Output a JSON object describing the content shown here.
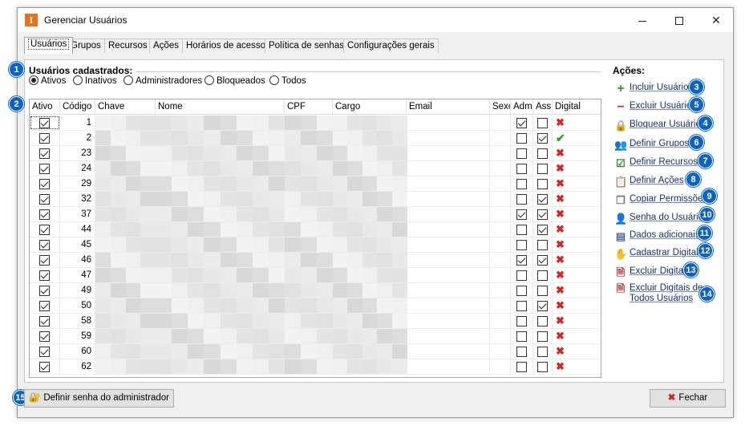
{
  "window": {
    "title": "Gerenciar Usuários",
    "app_icon": "I"
  },
  "tabs": [
    {
      "label": "Usuários",
      "active": true
    },
    {
      "label": "Grupos"
    },
    {
      "label": "Recursos"
    },
    {
      "label": "Ações"
    },
    {
      "label": "Horários de acesso"
    },
    {
      "label": "Política de senhas"
    },
    {
      "label": "Configurações gerais"
    }
  ],
  "users": {
    "section_title": "Usuários cadastrados:",
    "filters": [
      {
        "label": "Ativos",
        "selected": true
      },
      {
        "label": "Inativos"
      },
      {
        "label": "Administradores"
      },
      {
        "label": "Bloqueados"
      },
      {
        "label": "Todos"
      }
    ],
    "columns": [
      "Ativo",
      "Código",
      "Chave",
      "Nome",
      "CPF",
      "Cargo",
      "Email",
      "Sexo",
      "Adm",
      "Ass.",
      "Digital"
    ],
    "rows": [
      {
        "code": "1",
        "active": true,
        "adm": true,
        "ass": false,
        "digital": "x"
      },
      {
        "code": "2",
        "active": true,
        "adm": false,
        "ass": true,
        "digital": "ok"
      },
      {
        "code": "23",
        "active": true,
        "adm": false,
        "ass": false,
        "digital": "x"
      },
      {
        "code": "24",
        "active": true,
        "adm": false,
        "ass": false,
        "digital": "x"
      },
      {
        "code": "29",
        "active": true,
        "adm": false,
        "ass": false,
        "digital": "x"
      },
      {
        "code": "32",
        "active": true,
        "adm": false,
        "ass": true,
        "digital": "x"
      },
      {
        "code": "37",
        "active": true,
        "adm": true,
        "ass": true,
        "digital": "x"
      },
      {
        "code": "44",
        "active": true,
        "adm": false,
        "ass": true,
        "digital": "x"
      },
      {
        "code": "45",
        "active": true,
        "adm": false,
        "ass": false,
        "digital": "x"
      },
      {
        "code": "46",
        "active": true,
        "adm": true,
        "ass": true,
        "digital": "x"
      },
      {
        "code": "47",
        "active": true,
        "adm": false,
        "ass": false,
        "digital": "x"
      },
      {
        "code": "49",
        "active": true,
        "adm": false,
        "ass": false,
        "digital": "x"
      },
      {
        "code": "50",
        "active": true,
        "adm": false,
        "ass": true,
        "digital": "x"
      },
      {
        "code": "58",
        "active": true,
        "adm": false,
        "ass": false,
        "digital": "x"
      },
      {
        "code": "59",
        "active": true,
        "adm": false,
        "ass": false,
        "digital": "x"
      },
      {
        "code": "60",
        "active": true,
        "adm": false,
        "ass": false,
        "digital": "x"
      },
      {
        "code": "62",
        "active": true,
        "adm": false,
        "ass": false,
        "digital": "x"
      }
    ]
  },
  "actions": {
    "title": "Ações:",
    "items": [
      {
        "label": "Incluir Usuário",
        "icon": "plus-icon",
        "badge": "3"
      },
      {
        "label": "Excluir Usuário",
        "icon": "minus-icon",
        "badge": "5"
      },
      {
        "label": "Bloquear Usuário",
        "icon": "lock-user-icon",
        "badge": "4"
      },
      {
        "label": "Definir Grupos",
        "icon": "group-icon",
        "badge": "6"
      },
      {
        "label": "Definir Recursos",
        "icon": "checklist-icon",
        "badge": "7"
      },
      {
        "label": "Definir Ações",
        "icon": "clipboard-icon",
        "badge": "8"
      },
      {
        "label": "Copiar Permissões",
        "icon": "copy-icon",
        "badge": "9"
      },
      {
        "label": "Senha do Usuário",
        "icon": "user-key-icon",
        "badge": "10"
      },
      {
        "label": "Dados adicionais",
        "icon": "form-add-icon",
        "badge": "11"
      },
      {
        "label": "Cadastrar Digital",
        "icon": "hand-icon",
        "badge": "12"
      },
      {
        "label": "Excluir Digital",
        "icon": "doc-delete-icon",
        "badge": "13"
      },
      {
        "label_line1": "Excluir Digitais de",
        "label_line2": "Todos Usuários",
        "icon": "doc-delete-all-icon",
        "badge": "14"
      }
    ]
  },
  "badges": {
    "filters": "1",
    "grid": "2",
    "admin_password": "15"
  },
  "footer": {
    "admin_password_button": "Definir senha do administrador",
    "close_button": "Fechar"
  },
  "colors": {
    "badge": "#0b63c6",
    "digital_missing": "#d9231c",
    "digital_ok": "#22a022",
    "link": "#15307a"
  }
}
